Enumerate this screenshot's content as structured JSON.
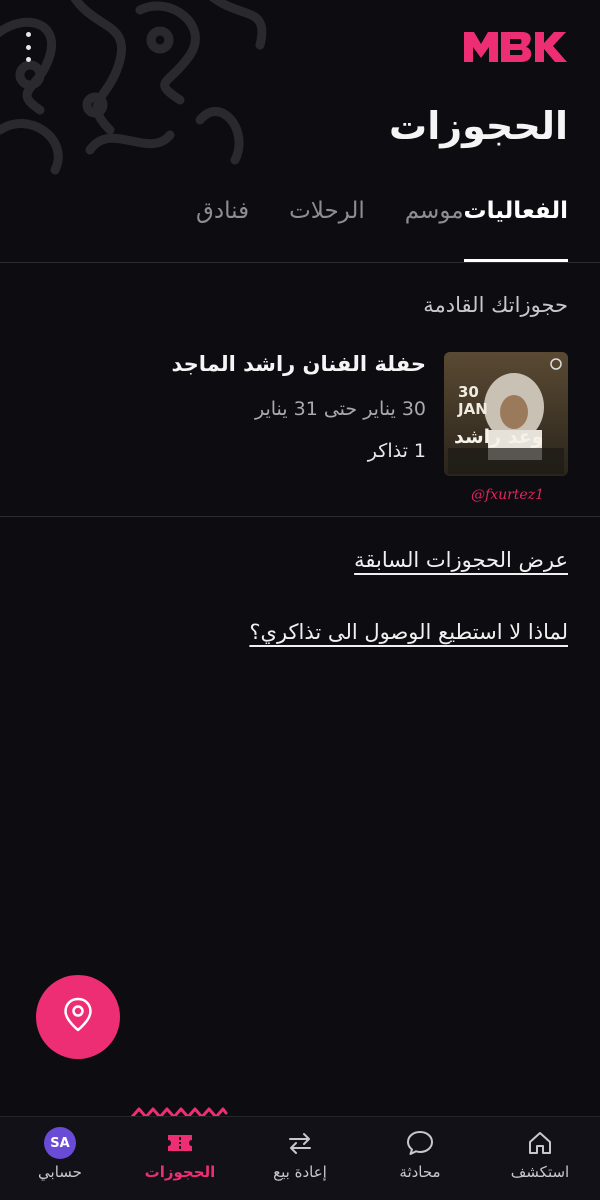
{
  "header": {
    "logo_text": "MBK",
    "title": "الحجوزات"
  },
  "tabs": [
    {
      "label": "الفعاليات",
      "active": true
    },
    {
      "label": "موسم",
      "active": false
    },
    {
      "label": "الرحلات",
      "active": false
    },
    {
      "label": "فنادق",
      "active": false
    }
  ],
  "upcoming": {
    "section_title": "حجوزاتك القادمة",
    "booking": {
      "title": "حفلة الفنان راشد الماجد",
      "dates": "30 يناير  حتى 31 يناير",
      "tickets": "1 تذاكر",
      "poster_text": "وعد راشد",
      "poster_date": "30 JAN"
    },
    "watermark": "@fxurtez1"
  },
  "links": {
    "past_bookings": "عرض الحجوزات السابقة",
    "cant_access": "لماذا لا استطيع الوصول الى تذاكري؟"
  },
  "fab": {
    "icon": "location-pin-icon"
  },
  "bottom_nav": [
    {
      "label": "استكشف",
      "icon": "home-icon",
      "active": false
    },
    {
      "label": "محادثة",
      "icon": "chat-bubble-icon",
      "active": false
    },
    {
      "label": "إعادة بيع",
      "icon": "resale-arrows-icon",
      "active": false
    },
    {
      "label": "الحجوزات",
      "icon": "ticket-icon",
      "active": true
    },
    {
      "label": "حسابي",
      "icon": "avatar",
      "avatar_initials": "SA",
      "active": false
    }
  ],
  "colors": {
    "background": "#0d0c10",
    "accent": "#ee2e74",
    "avatar": "#6a4bd6"
  }
}
